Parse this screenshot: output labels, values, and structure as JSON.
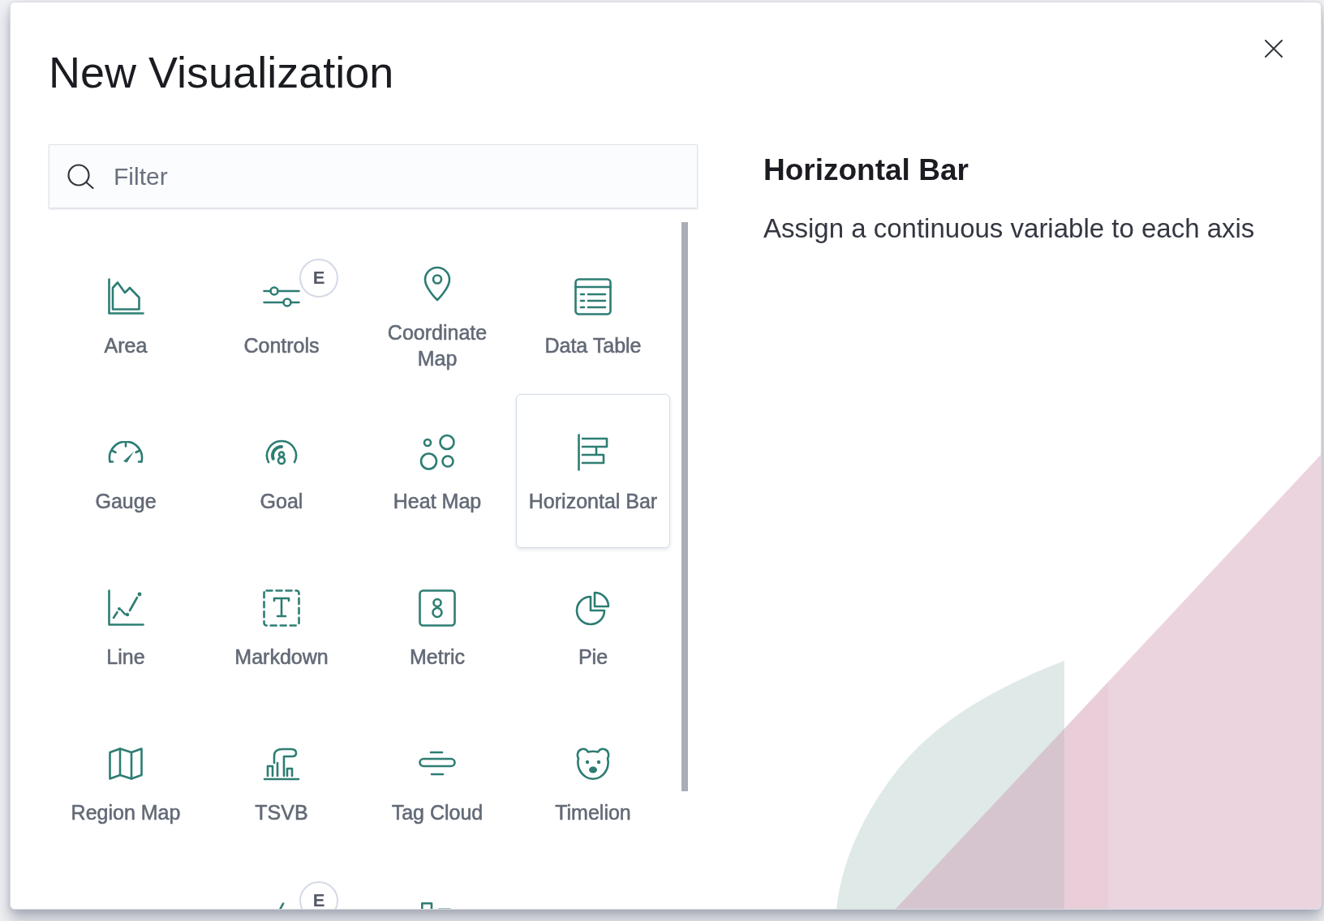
{
  "dialog": {
    "title": "New Visualization"
  },
  "filter": {
    "placeholder": "Filter"
  },
  "types": [
    {
      "label": "Area",
      "kind": "area",
      "selected": false
    },
    {
      "label": "Controls",
      "kind": "controls",
      "badge": "E",
      "selected": false
    },
    {
      "label": "Coordinate Map",
      "kind": "coordinatemap",
      "selected": false
    },
    {
      "label": "Data Table",
      "kind": "datatable",
      "selected": false
    },
    {
      "label": "Gauge",
      "kind": "gauge",
      "selected": false
    },
    {
      "label": "Goal",
      "kind": "goal",
      "selected": false
    },
    {
      "label": "Heat Map",
      "kind": "heatmap",
      "selected": false
    },
    {
      "label": "Horizontal Bar",
      "kind": "horizontalbar",
      "selected": true
    },
    {
      "label": "Line",
      "kind": "line",
      "selected": false
    },
    {
      "label": "Markdown",
      "kind": "markdown",
      "selected": false
    },
    {
      "label": "Metric",
      "kind": "metric",
      "selected": false
    },
    {
      "label": "Pie",
      "kind": "pie",
      "selected": false
    },
    {
      "label": "Region Map",
      "kind": "regionmap",
      "selected": false
    },
    {
      "label": "TSVB",
      "kind": "tsvb",
      "selected": false
    },
    {
      "label": "Tag Cloud",
      "kind": "tagcloud",
      "selected": false
    },
    {
      "label": "Timelion",
      "kind": "timelion",
      "selected": false
    }
  ],
  "clipped_types": [
    {
      "kind": "stroke",
      "badge": "E",
      "selected": false
    },
    {
      "kind": "bars",
      "selected": false
    }
  ],
  "details": {
    "title": "Horizontal Bar",
    "description": "Assign a continuous variable to each axis"
  }
}
